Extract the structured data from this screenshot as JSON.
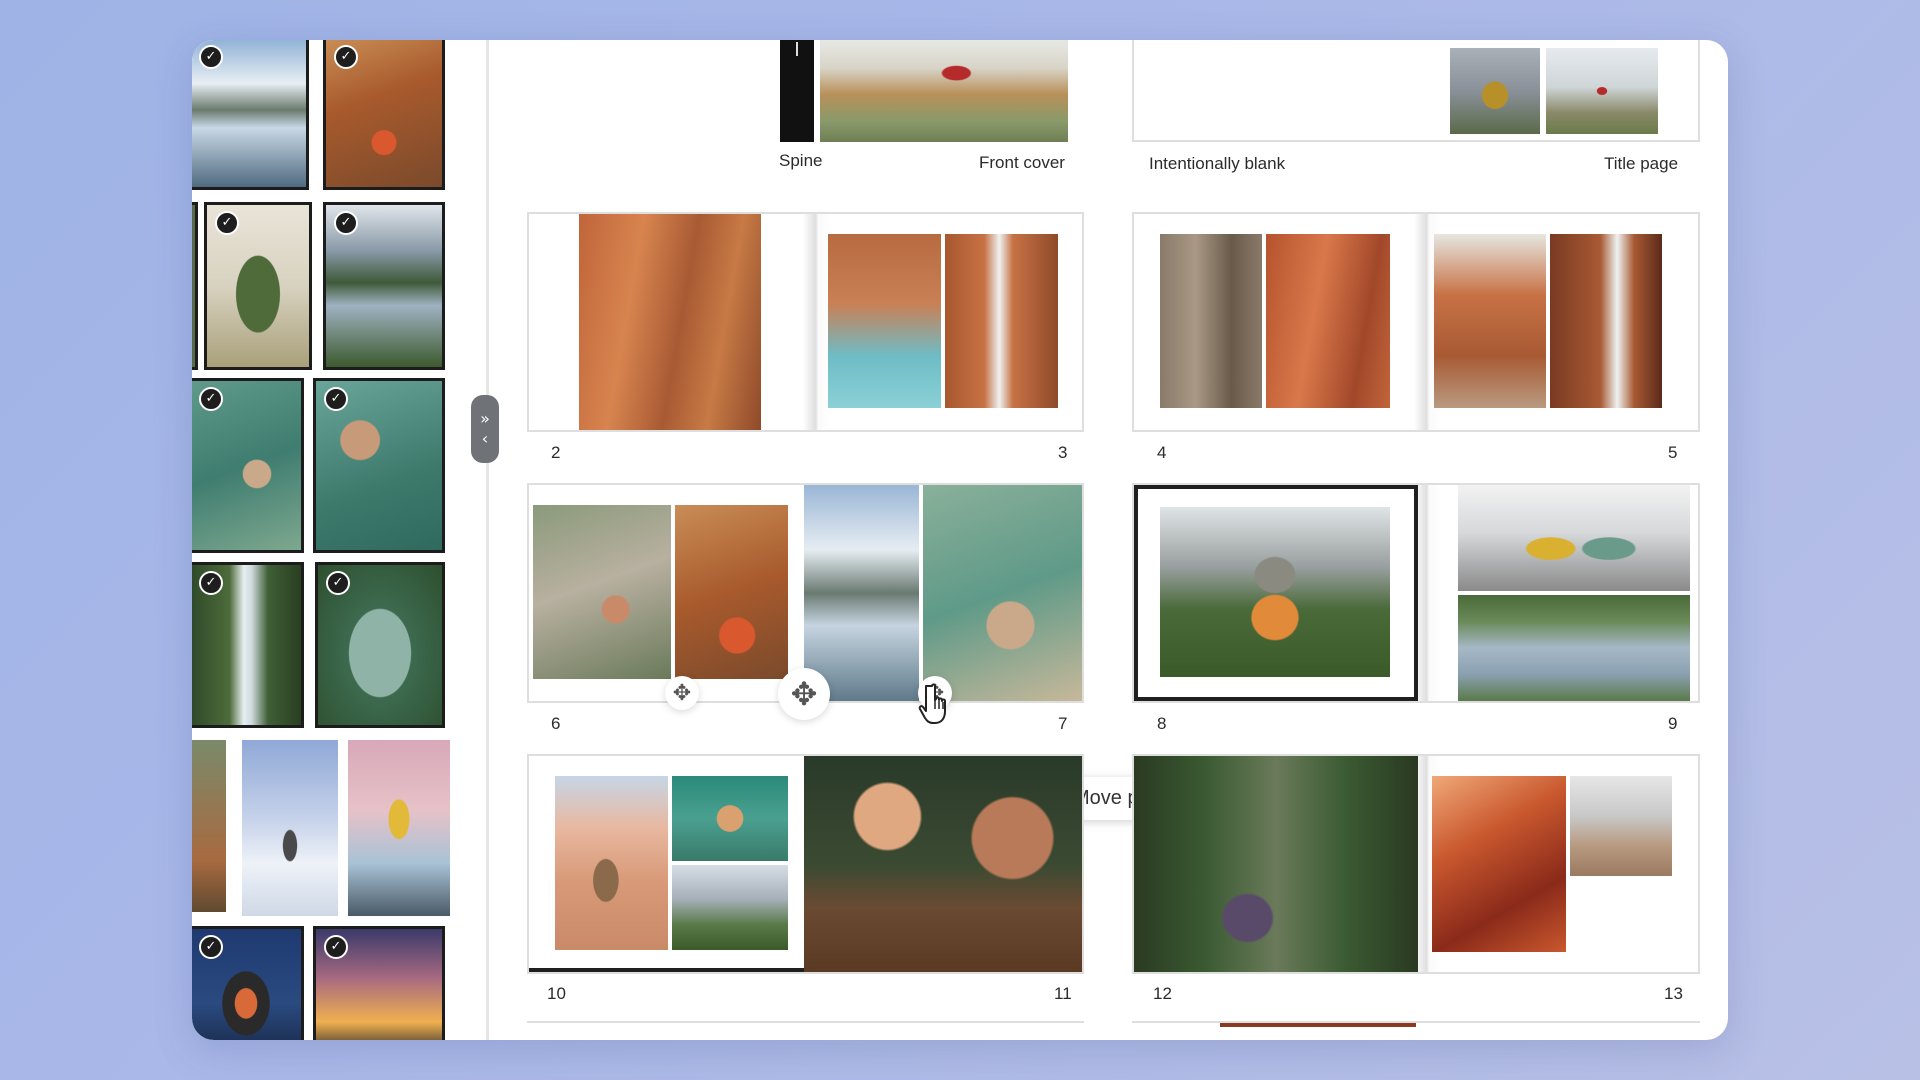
{
  "book": {
    "top_captions": {
      "spine": "Spine",
      "front_cover": "Front cover",
      "intentionally_blank": "Intentionally blank",
      "title_page": "Title page"
    },
    "page_numbers": [
      "2",
      "3",
      "4",
      "5",
      "6",
      "7",
      "8",
      "9",
      "10",
      "11",
      "12",
      "13"
    ]
  },
  "sidebar": {
    "collapse_handle_icons": [
      "double-chevron-right-icon",
      "chevron-left-icon"
    ],
    "check_glyph": "✓"
  },
  "tooltip": {
    "label": "Move page"
  },
  "icons": {
    "move": "✥"
  },
  "colors": {
    "background": "#a9b8e6",
    "window": "#ffffff",
    "selected_border": "#1f1f1f",
    "handle": "#6f7277"
  }
}
